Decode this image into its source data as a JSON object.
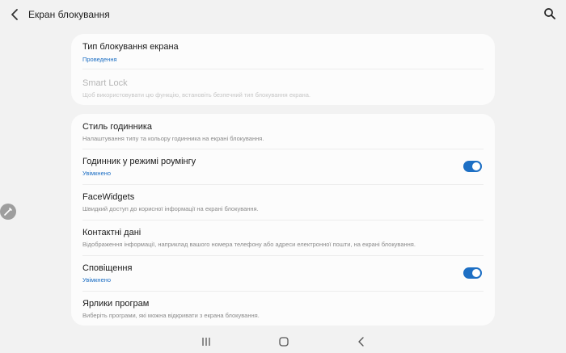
{
  "header": {
    "title": "Екран блокування",
    "back_icon": "chevron-left-icon",
    "search_icon": "search-icon"
  },
  "sections": [
    {
      "items": [
        {
          "label": "Тип блокування екрана",
          "sublabel": "Проведення",
          "sublabel_accent": true
        },
        {
          "label": "Smart Lock",
          "sublabel": "Щоб використовувати цю функцію, встановіть безпечний тип блокування екрана.",
          "disabled": true
        }
      ]
    },
    {
      "items": [
        {
          "label": "Стиль годинника",
          "sublabel": "Налаштування типу та кольору годинника на екрані блокування."
        },
        {
          "label": "Годинник у режимі роумінгу",
          "sublabel": "Увімкнено",
          "sublabel_accent": true,
          "toggle": true
        },
        {
          "label": "FaceWidgets",
          "sublabel": "Швидкий доступ до корисної інформації на екрані блокування."
        },
        {
          "label": "Контактні дані",
          "sublabel": "Відображення інформації, наприклад вашого номера телефону або адреси електронної пошти, на екрані блокування."
        },
        {
          "label": "Сповіщення",
          "sublabel": "Увімкнено",
          "sublabel_accent": true,
          "toggle": true
        },
        {
          "label": "Ярлики програм",
          "sublabel": "Виберіть програми, які можна відкривати з екрана блокування."
        }
      ]
    }
  ],
  "edge_handle_icon": "pencil-icon",
  "navbar": {
    "recents_icon": "recents-icon",
    "home_icon": "home-icon",
    "back_icon": "nav-back-icon"
  },
  "colors": {
    "accent": "#1d6fc4",
    "background": "#f2f2f2",
    "card": "#fcfcfc"
  }
}
